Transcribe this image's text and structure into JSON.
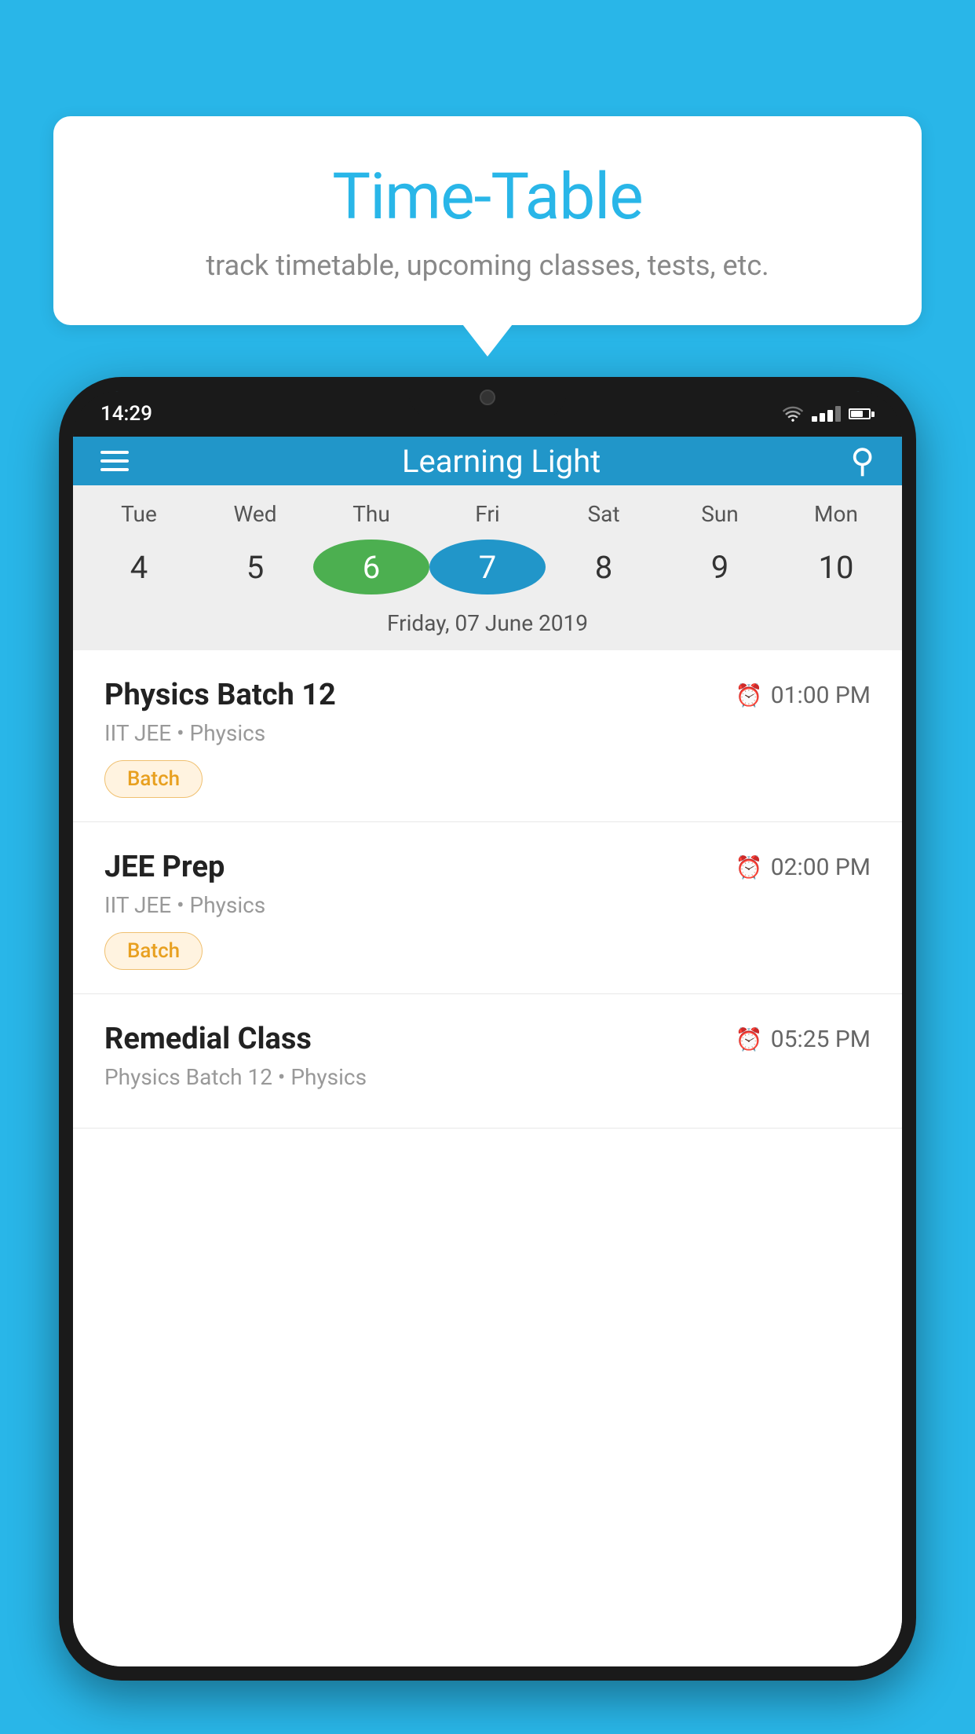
{
  "background_color": "#29B6E8",
  "speech_bubble": {
    "title": "Time-Table",
    "subtitle": "track timetable, upcoming classes, tests, etc."
  },
  "phone": {
    "status_bar": {
      "time": "14:29"
    },
    "app_bar": {
      "title": "Learning Light",
      "menu_icon": "hamburger-icon",
      "search_icon": "search-icon"
    },
    "calendar": {
      "days": [
        {
          "name": "Tue",
          "number": "4",
          "state": "normal"
        },
        {
          "name": "Wed",
          "number": "5",
          "state": "normal"
        },
        {
          "name": "Thu",
          "number": "6",
          "state": "today"
        },
        {
          "name": "Fri",
          "number": "7",
          "state": "selected"
        },
        {
          "name": "Sat",
          "number": "8",
          "state": "normal"
        },
        {
          "name": "Sun",
          "number": "9",
          "state": "normal"
        },
        {
          "name": "Mon",
          "number": "10",
          "state": "normal"
        }
      ],
      "selected_date_label": "Friday, 07 June 2019"
    },
    "classes": [
      {
        "name": "Physics Batch 12",
        "time": "01:00 PM",
        "meta": "IIT JEE • Physics",
        "badge": "Batch"
      },
      {
        "name": "JEE Prep",
        "time": "02:00 PM",
        "meta": "IIT JEE • Physics",
        "badge": "Batch"
      },
      {
        "name": "Remedial Class",
        "time": "05:25 PM",
        "meta": "Physics Batch 12 • Physics",
        "badge": null
      }
    ]
  }
}
